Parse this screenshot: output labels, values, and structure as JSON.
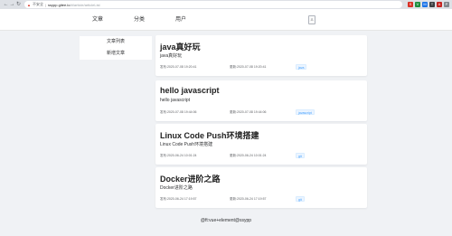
{
  "browser": {
    "insecure_label": "不安全",
    "url_host": "ssypp.gitee.io",
    "url_path": "/#/article/articleList",
    "extensions": [
      {
        "name": "extension-red-icon",
        "color": "#d93025",
        "glyph": "S"
      },
      {
        "name": "extension-green-icon",
        "color": "#1e8e3e",
        "glyph": "V"
      },
      {
        "name": "extension-blue-icon",
        "color": "#1a73e8",
        "glyph": "M"
      },
      {
        "name": "extension-dark-icon",
        "color": "#3c4043",
        "glyph": "T"
      },
      {
        "name": "extension-red2-icon",
        "color": "#c5221f",
        "glyph": "A"
      },
      {
        "name": "extension-gray-icon",
        "color": "#80868b",
        "glyph": "P"
      }
    ]
  },
  "nav": {
    "items": [
      {
        "label": "文章"
      },
      {
        "label": "分类"
      },
      {
        "label": "用户"
      }
    ]
  },
  "sidebar": {
    "items": [
      {
        "label": "文章列表"
      },
      {
        "label": "新增文章"
      }
    ]
  },
  "articles": [
    {
      "title": "java真好玩",
      "desc": "java真好玩",
      "created": "发布:2020-07-08 19:20:41",
      "updated": "更新:2020-07-08 19:20:41",
      "tag": "java"
    },
    {
      "title": "hello javascript",
      "desc": "hello javascript",
      "created": "发布:2020-07-08 19:44:06",
      "updated": "更新:2020-07-08 19:44:06",
      "tag": "javascript"
    },
    {
      "title": "Linux Code Push环境搭建",
      "desc": "Linux Code Push环境搭建",
      "created": "发布:2020-06-24 10:01:24",
      "updated": "更新:2020-06-24 10:01:24",
      "tag": "git"
    },
    {
      "title": "Docker进阶之路",
      "desc": "Docker进阶之路",
      "created": "发布:2020-06-24 17:19:57",
      "updated": "更新:2020-06-24 17:19:57",
      "tag": "git"
    }
  ],
  "footer": {
    "text": "@ft:vue+element@ssypp"
  }
}
